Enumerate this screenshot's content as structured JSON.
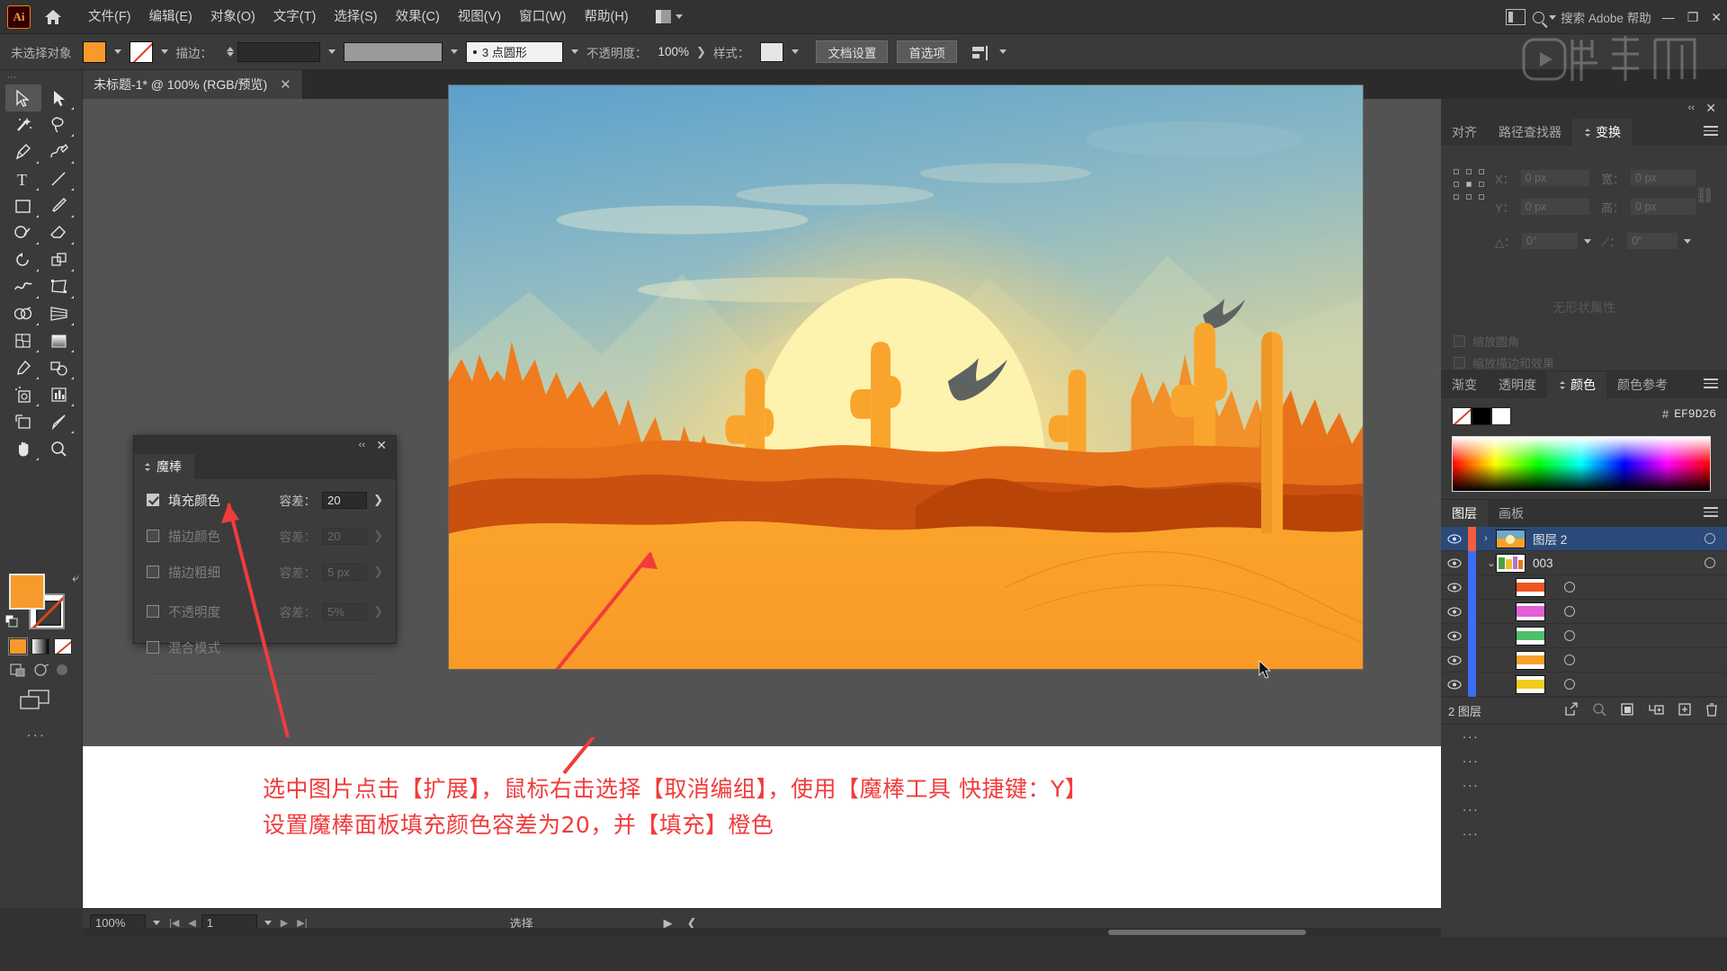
{
  "app": {
    "logo": "Ai",
    "home_icon": "home-icon"
  },
  "menubar": {
    "items": [
      {
        "label": "文件(F)"
      },
      {
        "label": "编辑(E)"
      },
      {
        "label": "对象(O)"
      },
      {
        "label": "文字(T)"
      },
      {
        "label": "选择(S)"
      },
      {
        "label": "效果(C)"
      },
      {
        "label": "视图(V)"
      },
      {
        "label": "窗口(W)"
      },
      {
        "label": "帮助(H)"
      }
    ],
    "search_placeholder": "搜索 Adobe 帮助",
    "minimize": "—",
    "maximize": "❐",
    "close": "✕"
  },
  "controlbar": {
    "selection_status": "未选择对象",
    "stroke_label": "描边：",
    "brush_label": "3 点圆形",
    "opacity_label": "不透明度：",
    "opacity_value": "100%",
    "style_label": "样式：",
    "doc_setup_button": "文档设置",
    "prefs_button": "首选项",
    "fill_color": "#F89A2B",
    "stroke_color": "none"
  },
  "tabbar": {
    "document_title": "未标题-1* @ 100% (RGB/预览)",
    "close": "✕"
  },
  "toolbar": {
    "tools": [
      {
        "name": "selection-tool",
        "selected": true
      },
      {
        "name": "direct-selection-tool",
        "selected": false
      },
      {
        "name": "magic-wand-tool",
        "selected": false
      },
      {
        "name": "lasso-tool",
        "selected": false
      },
      {
        "name": "pen-tool",
        "selected": false
      },
      {
        "name": "curvature-tool",
        "selected": false
      },
      {
        "name": "type-tool",
        "selected": false
      },
      {
        "name": "line-tool",
        "selected": false
      },
      {
        "name": "rectangle-tool",
        "selected": false
      },
      {
        "name": "paintbrush-tool",
        "selected": false
      },
      {
        "name": "shaper-tool",
        "selected": false
      },
      {
        "name": "eraser-tool",
        "selected": false
      },
      {
        "name": "rotate-tool",
        "selected": false
      },
      {
        "name": "scale-tool",
        "selected": false
      },
      {
        "name": "width-tool",
        "selected": false
      },
      {
        "name": "free-transform-tool",
        "selected": false
      },
      {
        "name": "shape-builder-tool",
        "selected": false
      },
      {
        "name": "perspective-grid-tool",
        "selected": false
      },
      {
        "name": "mesh-tool",
        "selected": false
      },
      {
        "name": "gradient-tool",
        "selected": false
      },
      {
        "name": "eyedropper-tool",
        "selected": false
      },
      {
        "name": "blend-tool",
        "selected": false
      },
      {
        "name": "symbol-sprayer-tool",
        "selected": false
      },
      {
        "name": "column-graph-tool",
        "selected": false
      },
      {
        "name": "artboard-tool",
        "selected": false
      },
      {
        "name": "slice-tool",
        "selected": false
      },
      {
        "name": "hand-tool",
        "selected": false
      },
      {
        "name": "zoom-tool",
        "selected": false
      }
    ],
    "fill_swatch": "#F89A2B",
    "stroke_swatch": "none",
    "more_tools": "..."
  },
  "wand_panel": {
    "title": "魔棒",
    "close": "✕",
    "collapse": "‹‹",
    "rows": [
      {
        "label": "填充颜色",
        "checked": true,
        "tol_label": "容差：",
        "tol_value": "20",
        "enabled": true
      },
      {
        "label": "描边颜色",
        "checked": false,
        "tol_label": "容差：",
        "tol_value": "20",
        "enabled": false
      },
      {
        "label": "描边粗细",
        "checked": false,
        "tol_label": "容差：",
        "tol_value": "5 px",
        "enabled": false
      },
      {
        "label": "不透明度",
        "checked": false,
        "tol_label": "容差：",
        "tol_value": "5%",
        "enabled": false
      },
      {
        "label": "混合模式",
        "checked": false,
        "tol_label": "",
        "tol_value": "",
        "enabled": false
      }
    ]
  },
  "annotation": {
    "line1": "选中图片点击【扩展】，鼠标右击选择【取消编组】，使用【魔棒工具 快捷键：Y】",
    "line2": "设置魔棒面板填充颜色容差为20，并【填充】橙色",
    "color": "#F23B3B"
  },
  "statusbar": {
    "zoom": "100%",
    "page": "1",
    "status_text": "选择"
  },
  "transform_panel": {
    "tabs": [
      {
        "label": "对齐",
        "active": false
      },
      {
        "label": "路径查找器",
        "active": false
      },
      {
        "label": "变换",
        "active": true
      }
    ],
    "x_label": "X：",
    "x_value": "0 px",
    "y_label": "Y：",
    "y_value": "0 px",
    "w_label": "宽：",
    "w_value": "0 px",
    "h_label": "高：",
    "h_value": "0 px",
    "angle_label": "△：",
    "angle_value": "0°",
    "shear_label": "⟋：",
    "shear_value": "0°",
    "scale_corners_label": "缩放圆角",
    "scale_strokes_label": "缩放描边和效果",
    "empty_message": "无形状属性",
    "close": "✕",
    "collapse": "‹‹"
  },
  "color_panel": {
    "tabs": [
      {
        "label": "渐变",
        "active": false
      },
      {
        "label": "透明度",
        "active": false
      },
      {
        "label": "颜色",
        "active": true
      },
      {
        "label": "颜色参考",
        "active": false
      }
    ],
    "hex_prefix": "#",
    "hex_value": "EF9D26"
  },
  "layers_panel": {
    "tabs": [
      {
        "label": "图层",
        "active": true
      },
      {
        "label": "画板",
        "active": false
      }
    ],
    "rows": [
      {
        "name": "图层 2",
        "selected": true,
        "indent": 0,
        "twisty": "›",
        "thumb": "sunset",
        "bar": "#f35e3e"
      },
      {
        "name": "003",
        "selected": false,
        "indent": 1,
        "twisty": "⌄",
        "thumb": "multicolor",
        "bar": "#3a6ff0"
      },
      {
        "name": "...",
        "selected": false,
        "indent": 2,
        "twisty": "",
        "thumb": "red",
        "bar": "#3a6ff0"
      },
      {
        "name": "...",
        "selected": false,
        "indent": 2,
        "twisty": "",
        "thumb": "magenta",
        "bar": "#3a6ff0"
      },
      {
        "name": "...",
        "selected": false,
        "indent": 2,
        "twisty": "",
        "thumb": "green",
        "bar": "#3a6ff0"
      },
      {
        "name": "...",
        "selected": false,
        "indent": 2,
        "twisty": "",
        "thumb": "orange",
        "bar": "#3a6ff0"
      },
      {
        "name": "...",
        "selected": false,
        "indent": 2,
        "twisty": "",
        "thumb": "yellow",
        "bar": "#3a6ff0"
      }
    ],
    "footer_count": "2 图层"
  },
  "artwork": {
    "description": "沙漠日落插画",
    "sky_top": "#6aa9cf",
    "sky_mid": "#a8c6b8",
    "sun": "#fdf0a8",
    "sand": "#f8a32c",
    "rock_dark": "#c04a10"
  }
}
